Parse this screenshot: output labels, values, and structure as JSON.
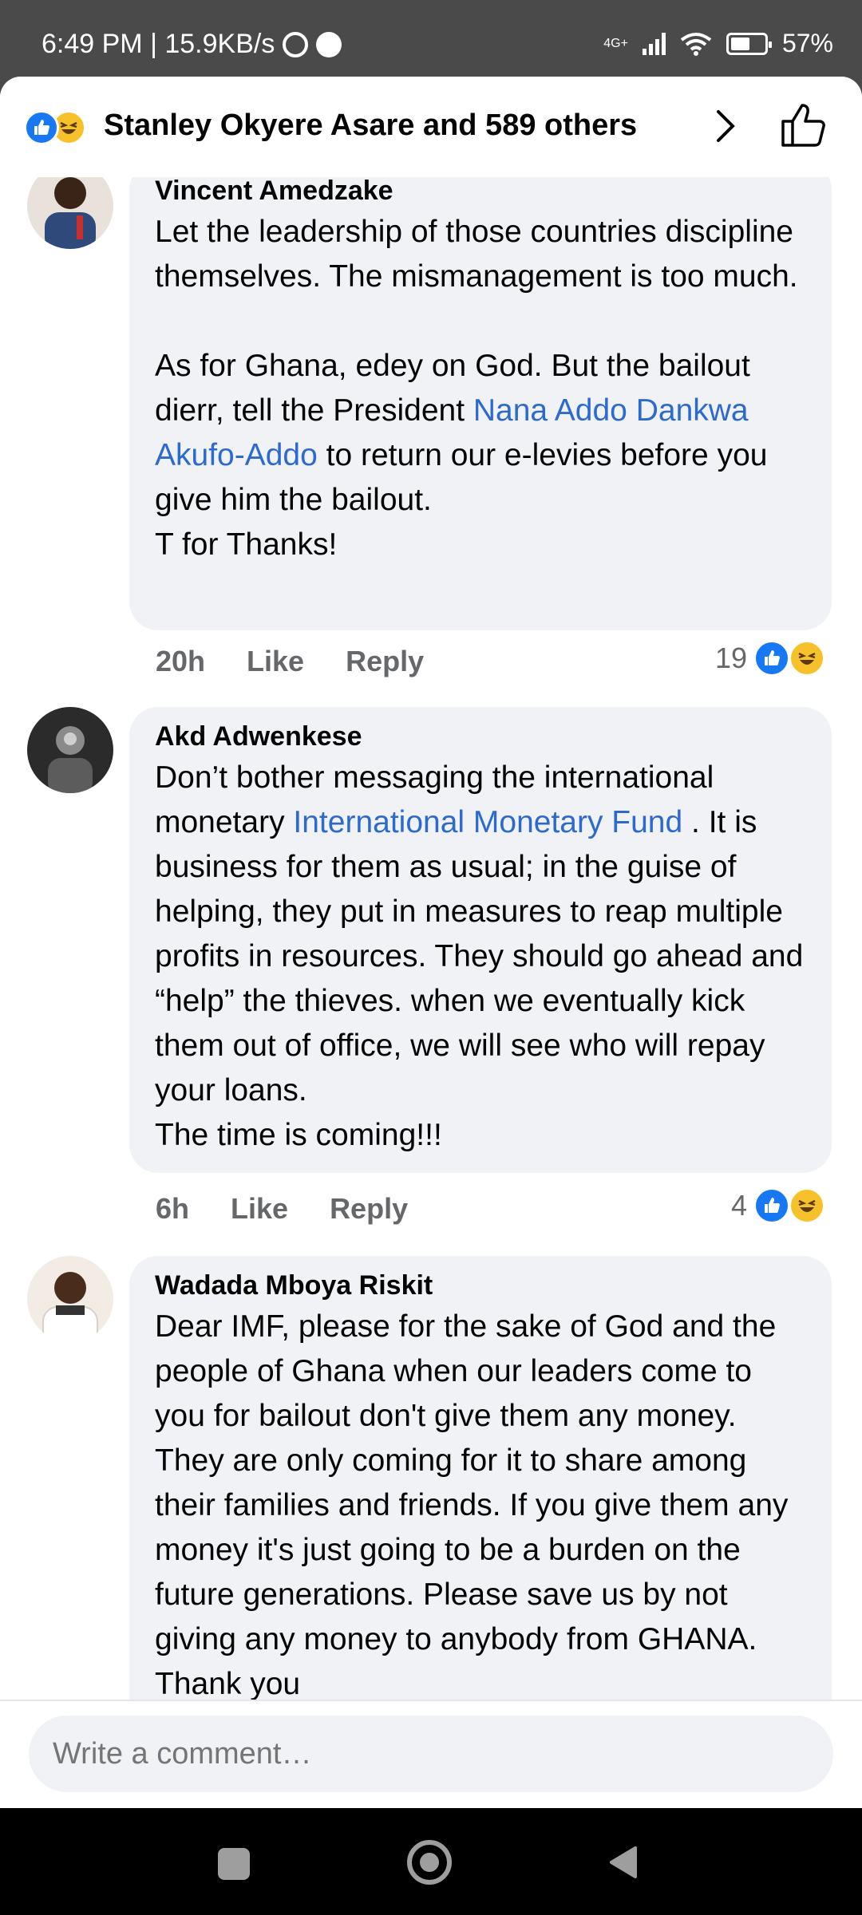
{
  "status_bar": {
    "time_speed": "6:49 PM | 15.9KB/s",
    "network": "4G+",
    "battery": "57%",
    "battery_level": 0.57
  },
  "reactions_header": {
    "label": "Stanley Okyere Asare and 589 others"
  },
  "comments": [
    {
      "author": "Vincent Amedzake",
      "text_a": "Let the leadership of those countries discipline themselves. The mismanagement is too much.",
      "text_b": "As for Ghana, edey on God. But the bailout dierr, tell the President ",
      "link": "Nana Addo Dankwa Akufo-Addo",
      "text_c": " to return our e-levies before you give him the bailout.",
      "text_d": "T for Thanks!",
      "time": "20h",
      "like_label": "Like",
      "reply_label": "Reply",
      "reaction_count": "19"
    },
    {
      "author": "Akd Adwenkese",
      "text_a": "Don’t bother messaging the international monetary ",
      "link": "International Monetary Fund",
      "text_b": " . It is business for them as usual; in the guise of helping, they put in measures to reap multiple profits in resources. They should go ahead and “help” the thieves. when we eventually kick them out of office, we will see who will repay your loans.",
      "text_c": "The time is coming!!!",
      "time": "6h",
      "like_label": "Like",
      "reply_label": "Reply",
      "reaction_count": "4"
    },
    {
      "author": "Wadada Mboya Riskit",
      "text_a": "Dear IMF, please for the sake of God and the people of Ghana when our leaders come to you for bailout don't give them any money. They are only coming for it to share among their families and friends. If you give them any money it's just going to be a burden on the future generations. Please save us by not giving any money to anybody from GHANA. Thank you"
    }
  ],
  "composer": {
    "placeholder": "Write a comment…"
  },
  "icons": {
    "like_reaction": "thumbs-up-icon",
    "haha_reaction": "laughing-face-icon",
    "chevron": "chevron-right-icon",
    "like_outline": "thumbs-up-outline-icon"
  },
  "colors": {
    "facebook_blue": "#1877f2",
    "link": "#2d6acf",
    "bubble": "#f0f2f5"
  }
}
